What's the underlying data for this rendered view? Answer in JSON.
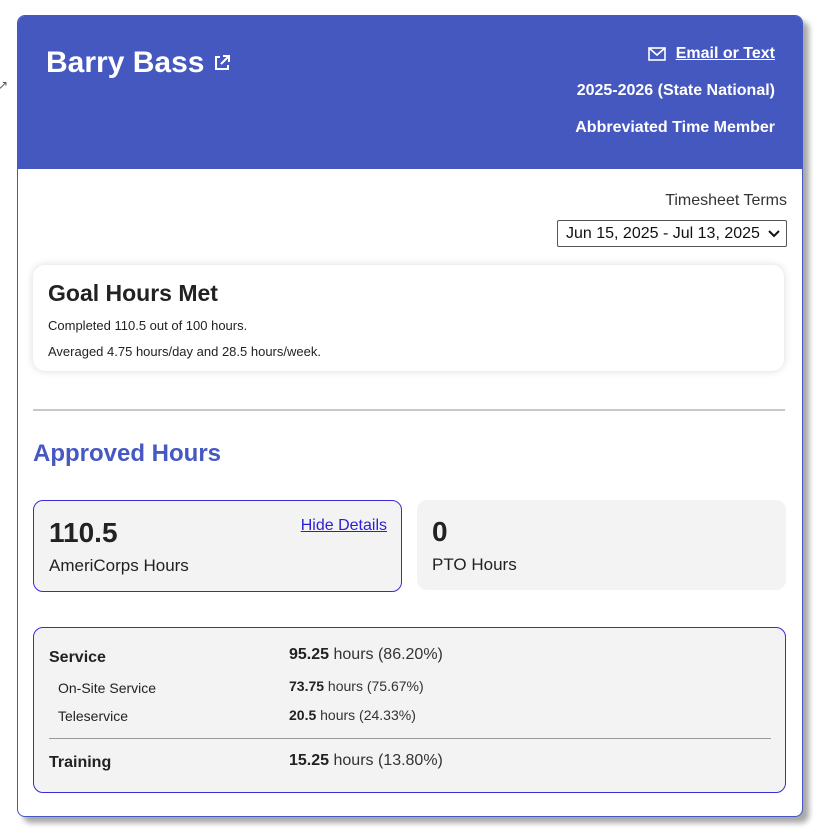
{
  "header": {
    "member_name": "Barry Bass",
    "contact_label": "Email or Text",
    "program_year": "2025-2026 (State National)",
    "member_type": "Abbreviated Time Member"
  },
  "timesheet": {
    "label": "Timesheet Terms",
    "selected_term": "Jun 15, 2025 - Jul 13, 2025"
  },
  "goal": {
    "title": "Goal Hours Met",
    "completed_text": "Completed 110.5 out of 100 hours.",
    "average_text": "Averaged 4.75 hours/day and 28.5 hours/week."
  },
  "approved": {
    "title": "Approved Hours",
    "americorps_value": "110.5",
    "americorps_label": "AmeriCorps Hours",
    "hide_details_label": "Hide Details",
    "pto_value": "0",
    "pto_label": "PTO Hours"
  },
  "details": {
    "service_label": "Service",
    "service_hours": "95.25",
    "service_rest": " hours (86.20%)",
    "onsite_label": "On-Site Service",
    "onsite_hours": "73.75",
    "onsite_rest": " hours (75.67%)",
    "tele_label": "Teleservice",
    "tele_hours": "20.5",
    "tele_rest": " hours (24.33%)",
    "training_label": "Training",
    "training_hours": "15.25",
    "training_rest": " hours (13.80%)"
  },
  "colors": {
    "header_bg": "#4558c0",
    "accent": "#4658c2",
    "link": "#2b1fd6",
    "panel_bg": "#f3f3f3"
  },
  "icons": {
    "external_link": "external-link-icon",
    "mail": "mail-icon",
    "dropdown": "chevron-down-icon"
  }
}
